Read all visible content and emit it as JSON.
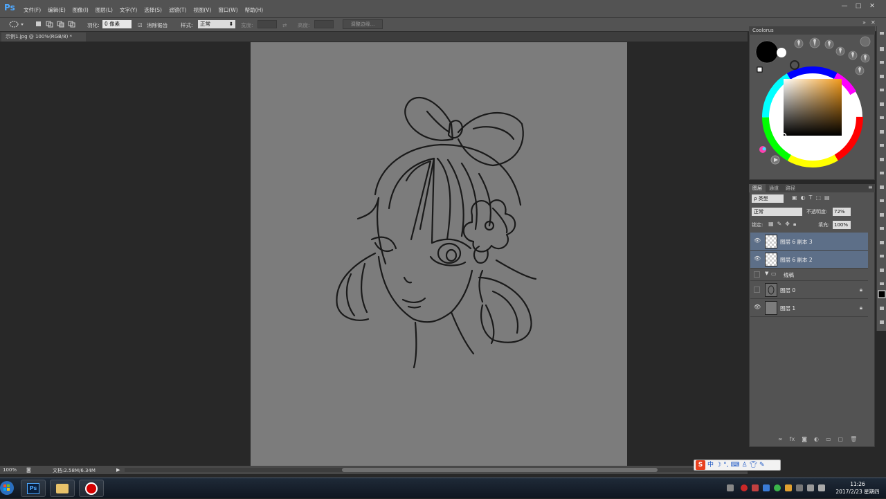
{
  "app": {
    "logo": "Ps"
  },
  "menu": [
    "文件(F)",
    "编辑(E)",
    "图像(I)",
    "图层(L)",
    "文字(Y)",
    "选择(S)",
    "滤镜(T)",
    "视图(V)",
    "窗口(W)",
    "帮助(H)"
  ],
  "window_controls": {
    "minimize": "—",
    "restore": "□",
    "close": "✕"
  },
  "options": {
    "feather_label": "羽化:",
    "feather_value": "0 像素",
    "antialias_label": "消除锯齿",
    "style_label": "样式:",
    "style_value": "正常",
    "width_label": "宽度:",
    "height_label": "高度:",
    "refine_button": "调整边缘..."
  },
  "document": {
    "tab_title": "示例1.jpg @ 100%(RGB/8) *"
  },
  "status": {
    "zoom": "100%",
    "doc_size": "文档:2.58M/6.34M"
  },
  "coolorus": {
    "title": "Coolorus"
  },
  "layers_panel": {
    "tabs": [
      "图层",
      "通道",
      "路径"
    ],
    "filter_kind": "ρ 类型",
    "blend_mode": "正常",
    "opacity_label": "不透明度:",
    "opacity_value": "72%",
    "lock_label": "锁定:",
    "fill_label": "填充:",
    "fill_value": "100%",
    "layers": [
      {
        "name": "图层 6 副本 3",
        "selected": true,
        "visible": true,
        "locked": false,
        "thumb": "checker"
      },
      {
        "name": "图层 6 副本 2",
        "selected": true,
        "visible": true,
        "locked": false,
        "thumb": "checker"
      },
      {
        "name": "线稿",
        "selected": false,
        "visible": false,
        "locked": false,
        "thumb": "folder"
      },
      {
        "name": "图层 0",
        "selected": false,
        "visible": false,
        "locked": true,
        "thumb": "sketch"
      },
      {
        "name": "图层 1",
        "selected": false,
        "visible": true,
        "locked": true,
        "thumb": "gray"
      }
    ]
  },
  "ime": {
    "lang": "中"
  },
  "clock": {
    "time": "11:26",
    "date": "2017/2/23 星期四"
  },
  "colors": {
    "ui_bg": "#535353",
    "workspace": "#282828",
    "canvas": "#7c7c7c",
    "selection": "#5d6f88",
    "ps_blue": "#4fa9ff"
  }
}
